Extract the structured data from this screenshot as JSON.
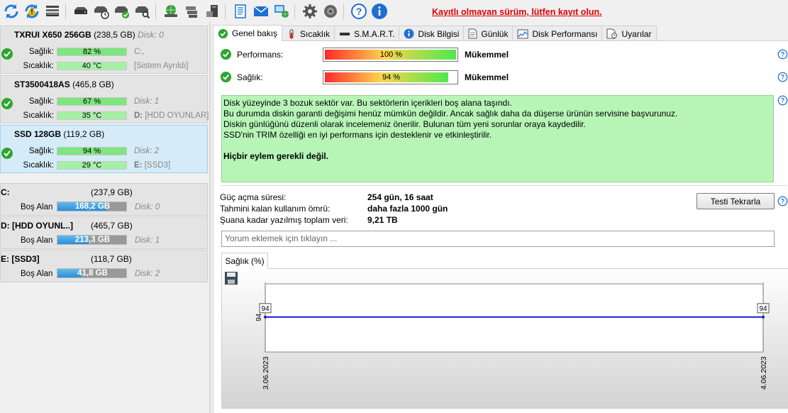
{
  "toolbar": {
    "icons": [
      "refresh-icon",
      "refresh-warning-icon",
      "drive-list-icon",
      "drive-icon",
      "drive-clock-icon",
      "drive-check-icon",
      "drive-search-icon",
      "globe-drive-icon",
      "drive-stack-icon",
      "drive-extra-icon",
      "notes-icon",
      "mail-icon",
      "network-monitor-icon",
      "settings-icon",
      "speaker-icon",
      "help-icon",
      "info-icon"
    ],
    "register_text": "Kayıtlı olmayan sürüm, lütfen kayıt olun.",
    "register_color": "#e00000"
  },
  "disks": [
    {
      "name": "TXRUI X650 256GB",
      "size": "(238,5 GB)",
      "disk_no": "Disk: 0",
      "health_label": "Sağlık:",
      "health_value": "82 %",
      "health": 0.82,
      "temp_label": "Sıcaklık:",
      "temp_value": "40 °C",
      "drive_letter": "C:,",
      "drive_desc": "[Sistem Ayrıldı]",
      "selected": false
    },
    {
      "name": "ST3500418AS",
      "size": "(465,8 GB)",
      "disk_no": "Disk: 1",
      "health_label": "Sağlık:",
      "health_value": "67 %",
      "health": 0.67,
      "temp_label": "Sıcaklık:",
      "temp_value": "35 °C",
      "drive_letter": "D:",
      "drive_desc": "[HDD OYUNLAR]",
      "selected": false
    },
    {
      "name": "SSD 128GB",
      "size": "(119,2 GB)",
      "disk_no": "Disk: 2",
      "health_label": "Sağlık:",
      "health_value": "94 %",
      "health": 0.94,
      "temp_label": "Sıcaklık:",
      "temp_value": "29 °C",
      "drive_letter": "E:",
      "drive_desc": "[SSD3]",
      "selected": true
    }
  ],
  "volumes": [
    {
      "name": "C:",
      "size": "(237,9 GB)",
      "free_label": "Boş Alan",
      "free_value": "168,2 GB",
      "free_fraction": 0.707,
      "disk_no": "Disk: 0"
    },
    {
      "name": "D: [HDD OYUNL..]",
      "size": "(465,7 GB)",
      "free_label": "Boş Alan",
      "free_value": "213,3 GB",
      "free_fraction": 0.458,
      "disk_no": "Disk: 1"
    },
    {
      "name": "E: [SSD3]",
      "size": "(118,7 GB)",
      "free_label": "Boş Alan",
      "free_value": "41,8 GB",
      "free_fraction": 0.352,
      "disk_no": "Disk: 2"
    }
  ],
  "tabs": [
    {
      "label": "Genel bakış",
      "icon": "check-circle-icon",
      "active": true
    },
    {
      "label": "Sıcaklık",
      "icon": "thermometer-icon",
      "active": false
    },
    {
      "label": "S.M.A.R.T.",
      "icon": "drive-bar-icon",
      "active": false
    },
    {
      "label": "Disk Bilgisi",
      "icon": "info-icon",
      "active": false
    },
    {
      "label": "Günlük",
      "icon": "log-page-icon",
      "active": false
    },
    {
      "label": "Disk Performansı",
      "icon": "performance-chart-icon",
      "active": false
    },
    {
      "label": "Uyarılar",
      "icon": "alerts-page-icon",
      "active": false
    }
  ],
  "overview": {
    "performance": {
      "label": "Performans:",
      "value": "100 %",
      "fraction": 1.0,
      "status": "Mükemmel"
    },
    "health": {
      "label": "Sağlık:",
      "value": "94 %",
      "fraction": 0.94,
      "status": "Mükemmel"
    },
    "message": [
      "Disk yüzeyinde 3 bozuk sektör var. Bu sektörlerin içerikleri boş alana taşındı.",
      "Bu durumda diskin garanti değişimi henüz mümkün değildir. Ancak sağlık daha da düşerse ürünün servisine başvurunuz.",
      "Diskin günlüğünü düzenli olarak incelemeniz önerilir. Bulunan tüm yeni sorunlar oraya kaydedilir.",
      "SSD'nin TRIM özelliği en iyi performans için desteklenir ve etkinleştirilir."
    ],
    "message_action": "Hiçbir eylem gerekli değil.",
    "stats": [
      {
        "label": "Güç açma süresi:",
        "value": "254 gün, 16 saat"
      },
      {
        "label": "Tahmini kalan kullanım ömrü:",
        "value": "daha fazla 1000 gün"
      },
      {
        "label": "Şuana kadar yazılmış toplam veri:",
        "value": "9,21 TB"
      }
    ],
    "retest_button": "Testi Tekrarla",
    "comment_placeholder": "Yorum eklemek için tıklayın ..."
  },
  "graph_tab": "Sağlık (%)",
  "chart_data": {
    "type": "line",
    "x": [
      "3.06.2023",
      "4.06.2023"
    ],
    "series": [
      {
        "values": [
          94,
          94
        ]
      }
    ],
    "data_labels": [
      "94",
      "94"
    ],
    "ylabel": "94",
    "color": "#1a1ad0"
  }
}
